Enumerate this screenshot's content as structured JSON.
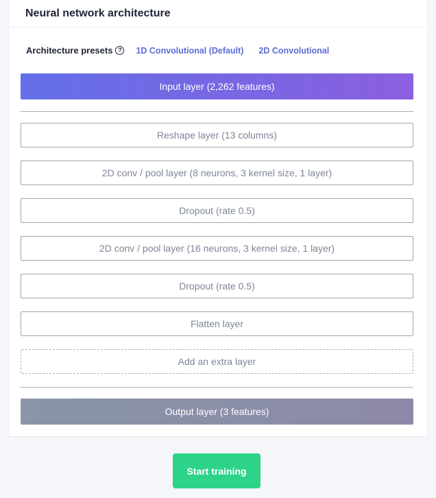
{
  "card": {
    "title": "Neural network architecture"
  },
  "presets": {
    "label": "Architecture presets",
    "help_icon_glyph": "?",
    "options": [
      "1D Convolutional (Default)",
      "2D Convolutional"
    ]
  },
  "layers": {
    "input": "Input layer (2,262 features)",
    "items": [
      "Reshape layer (13 columns)",
      "2D conv / pool layer (8 neurons, 3 kernel size, 1 layer)",
      "Dropout (rate 0.5)",
      "2D conv / pool layer (16 neurons, 3 kernel size, 1 layer)",
      "Dropout (rate 0.5)",
      "Flatten layer"
    ],
    "add_extra": "Add an extra layer",
    "output": "Output layer (3 features)"
  },
  "actions": {
    "start_training": "Start training"
  },
  "colors": {
    "input_gradient_start": "#6470e8",
    "input_gradient_end": "#8a5fe0",
    "output_gradient": "#8a95a8",
    "start_button": "#2ed38a",
    "preset_link": "#5b6bd6"
  }
}
